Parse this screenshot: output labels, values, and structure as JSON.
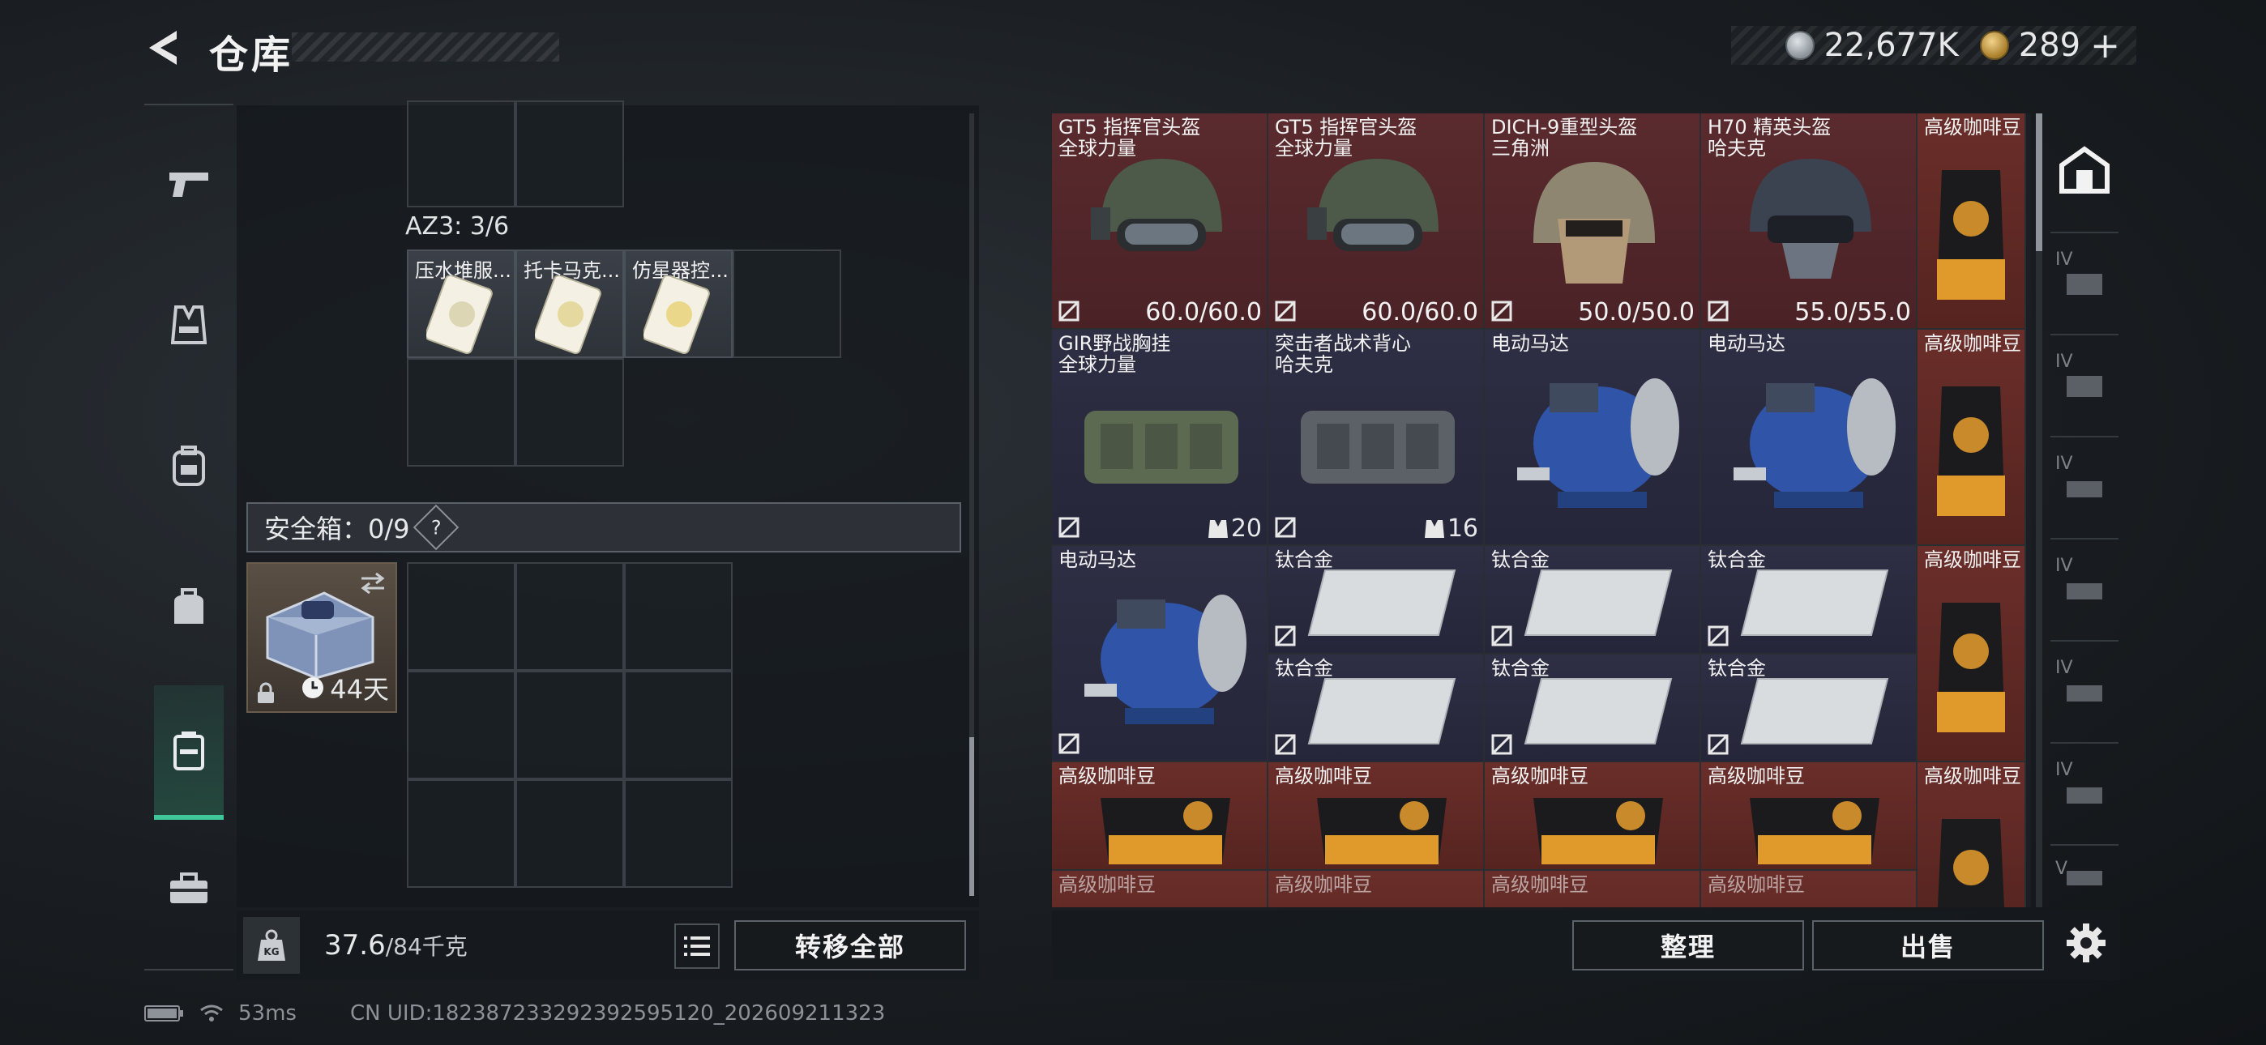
{
  "header": {
    "title": "仓库",
    "stripe_text": ""
  },
  "currency": [
    {
      "icon": "silver-coin-icon",
      "value": "22,677K",
      "color": "#b9c0c6"
    },
    {
      "icon": "gold-coin-icon",
      "value": "289",
      "suffix": "+",
      "color": "#d8b35a"
    }
  ],
  "tabs": [
    {
      "icon": "pistol-icon"
    },
    {
      "icon": "vest-icon"
    },
    {
      "icon": "backpack-icon"
    },
    {
      "icon": "bag-icon"
    },
    {
      "icon": "case-icon",
      "active": true
    },
    {
      "icon": "toolbox-icon"
    }
  ],
  "left": {
    "az3_label": "AZ3: 3/6",
    "az3_items": [
      "压水堆服...",
      "托卡马克...",
      "仿星器控..."
    ],
    "safe_label": "安全箱：0/9",
    "safe_help": "?",
    "safebox_days": "44天",
    "weight_value": "37.6",
    "weight_max": "/84千克",
    "transfer_all": "转移全部"
  },
  "stash": {
    "row1": [
      {
        "name": "GT5 指挥官头盔",
        "sub": "全球力量",
        "dur": "60.0/60.0"
      },
      {
        "name": "GT5 指挥官头盔",
        "sub": "全球力量",
        "dur": "60.0/60.0"
      },
      {
        "name": "DICH-9重型头盔",
        "sub": "三角洲",
        "dur": "50.0/50.0"
      },
      {
        "name": "H70 精英头盔",
        "sub": "哈夫克",
        "dur": "55.0/55.0"
      },
      {
        "name": "高级咖啡豆"
      }
    ],
    "row2": [
      {
        "name": "GIR野战胸挂",
        "sub": "全球力量",
        "cap": "20"
      },
      {
        "name": "突击者战术背心",
        "sub": "哈夫克",
        "cap": "16"
      },
      {
        "name": "电动马达"
      },
      {
        "name": "电动马达"
      },
      {
        "name": "高级咖啡豆"
      }
    ],
    "row3": {
      "motor": "电动马达",
      "titanium": [
        "钛合金",
        "钛合金",
        "钛合金",
        "钛合金",
        "钛合金",
        "钛合金"
      ],
      "coffee": "高级咖啡豆"
    },
    "row4": [
      "高级咖啡豆",
      "高级咖啡豆",
      "高级咖啡豆",
      "高级咖啡豆",
      "高级咖啡豆"
    ],
    "row5": [
      "高级咖啡豆",
      "高级咖啡豆",
      "高级咖啡豆",
      "高级咖啡豆"
    ],
    "side_tiers": [
      "IV",
      "IV",
      "IV",
      "IV",
      "IV",
      "IV",
      "V"
    ],
    "sort_label": "整理",
    "sell_label": "出售"
  },
  "status": {
    "ping": "53ms",
    "uid": "CN UID:1823872332923925951​20_202609211323"
  }
}
